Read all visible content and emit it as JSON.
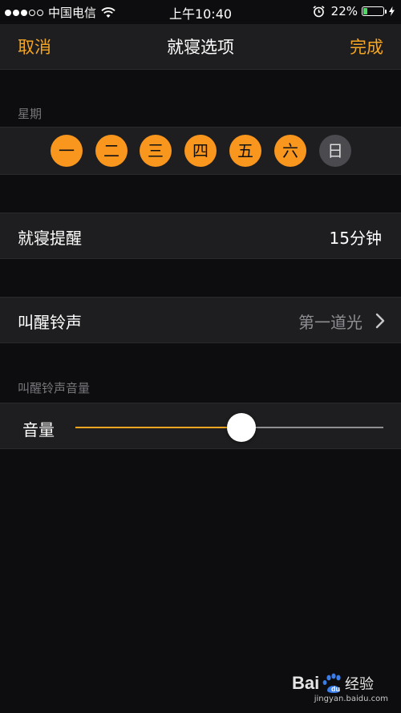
{
  "status_bar": {
    "signal_dots": [
      true,
      true,
      true,
      false,
      false
    ],
    "carrier": "中国电信",
    "time": "上午10:40",
    "battery_percent": "22%",
    "battery_level": 0.22,
    "icons": [
      "wifi-icon",
      "alarm-icon",
      "battery-icon",
      "bolt-icon"
    ]
  },
  "nav": {
    "cancel_label": "取消",
    "title": "就寝选项",
    "done_label": "完成"
  },
  "colors": {
    "accent": "#f5a623",
    "day_active": "#f8961e",
    "day_inactive": "#4b4a4e",
    "battery_green": "#4cd964",
    "background": "#0d0c0e",
    "cell": "#1e1d1f"
  },
  "weekday_section": {
    "label": "星期",
    "days": [
      {
        "label": "一",
        "selected": true
      },
      {
        "label": "二",
        "selected": true
      },
      {
        "label": "三",
        "selected": true
      },
      {
        "label": "四",
        "selected": true
      },
      {
        "label": "五",
        "selected": true
      },
      {
        "label": "六",
        "selected": true
      },
      {
        "label": "日",
        "selected": false
      }
    ]
  },
  "bedtime_reminder": {
    "label": "就寝提醒",
    "value": "15分钟"
  },
  "wake_sound": {
    "label": "叫醒铃声",
    "value": "第一道光",
    "icon": "chevron-right-icon"
  },
  "volume_section": {
    "label": "叫醒铃声音量",
    "slider_label": "音量",
    "level": 0.54
  },
  "watermark": {
    "url": "jingyan.baidu.com",
    "logo_text": "Bai 经验"
  }
}
